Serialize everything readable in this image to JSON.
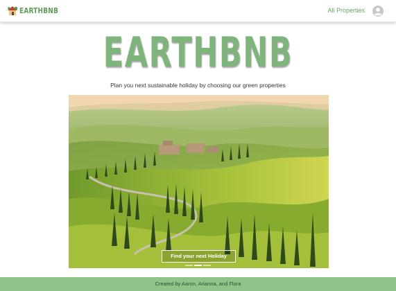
{
  "navbar": {
    "logo_text": "EARTHBNB",
    "all_properties_link": "All Properties",
    "logo_icon": "house-icon",
    "account_icon": "user-circle-icon"
  },
  "hero": {
    "title": "EARTHBNB",
    "tagline": "Plan you next sustainable holiday by choosing our green properties"
  },
  "carousel": {
    "image": "tuscany-landscape-photo",
    "cta_label": "Find your next Holiday",
    "slide_count": 3,
    "active_slide": 2
  },
  "footer": {
    "credit_text": "Created by Aaron, Arianna, and Flora"
  },
  "colors": {
    "brand_green": "#7fb47c",
    "footer_green": "#8cc48a",
    "link_green": "#6aa267"
  }
}
